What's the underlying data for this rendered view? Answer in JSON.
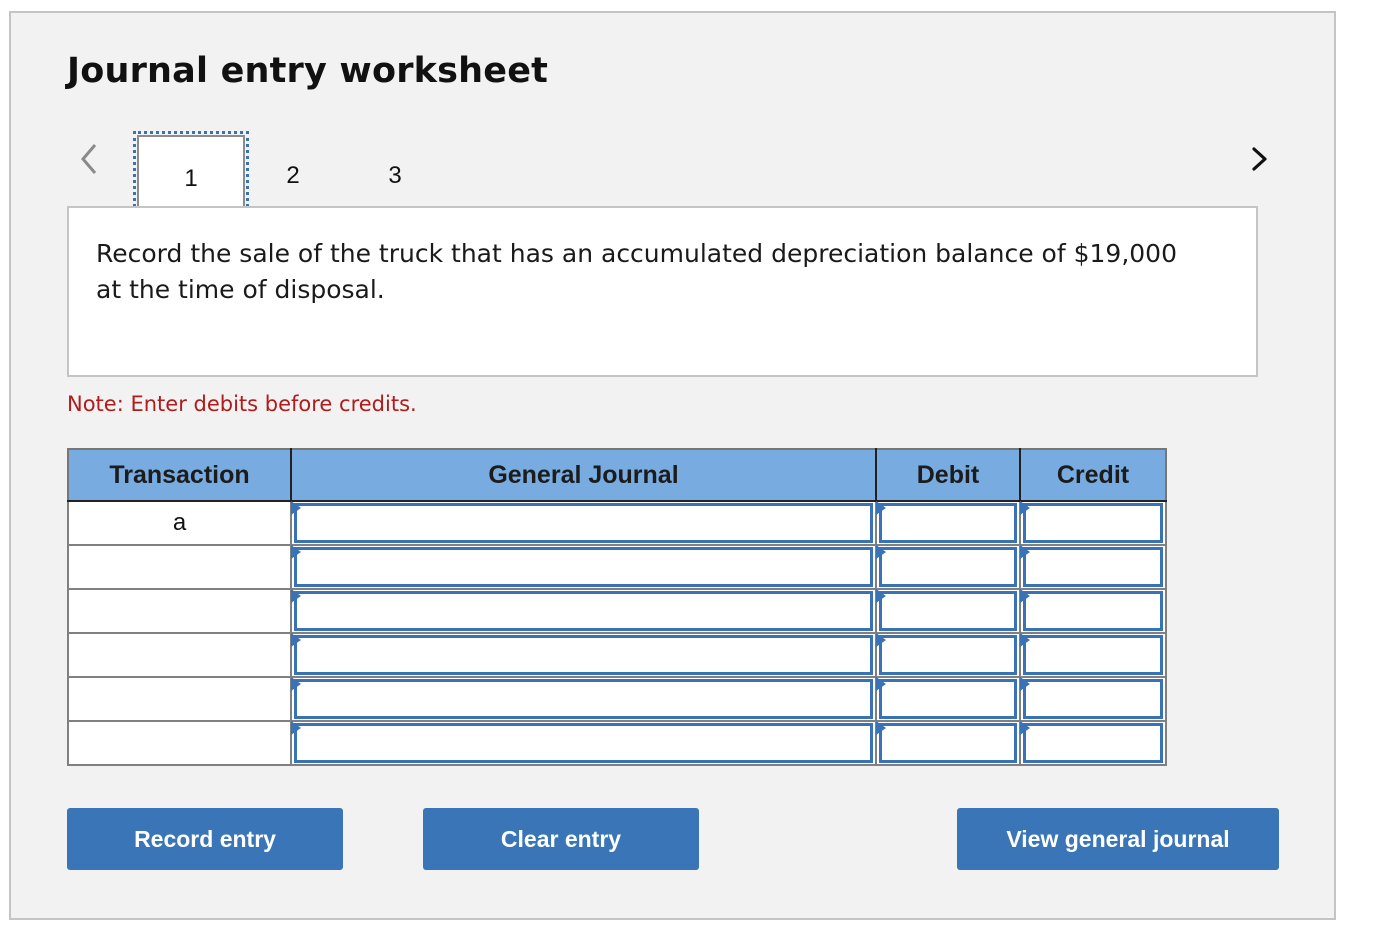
{
  "worksheet": {
    "title": "Journal entry worksheet",
    "navigation": {
      "prev_icon": "chevron-left-icon",
      "next_icon": "chevron-right-icon",
      "tabs": [
        {
          "label": "1",
          "active": true
        },
        {
          "label": "2",
          "active": false
        },
        {
          "label": "3",
          "active": false
        }
      ]
    },
    "question": "Record the sale of the truck that has an accumulated depreciation balance of $19,000 at the time of disposal.",
    "note": "Note: Enter debits before credits.",
    "table": {
      "headers": [
        "Transaction",
        "General Journal",
        "Debit",
        "Credit"
      ],
      "rows": [
        {
          "transaction": "a",
          "account": "",
          "debit": "",
          "credit": ""
        },
        {
          "transaction": "",
          "account": "",
          "debit": "",
          "credit": ""
        },
        {
          "transaction": "",
          "account": "",
          "debit": "",
          "credit": ""
        },
        {
          "transaction": "",
          "account": "",
          "debit": "",
          "credit": ""
        },
        {
          "transaction": "",
          "account": "",
          "debit": "",
          "credit": ""
        },
        {
          "transaction": "",
          "account": "",
          "debit": "",
          "credit": ""
        }
      ]
    },
    "buttons": {
      "record": "Record entry",
      "clear": "Clear entry",
      "view": "View general journal"
    },
    "colors": {
      "accent": "#3a76b7",
      "header_bg": "#78abe0",
      "note": "#b01c1c",
      "panel_bg": "#f2f2f2"
    }
  }
}
